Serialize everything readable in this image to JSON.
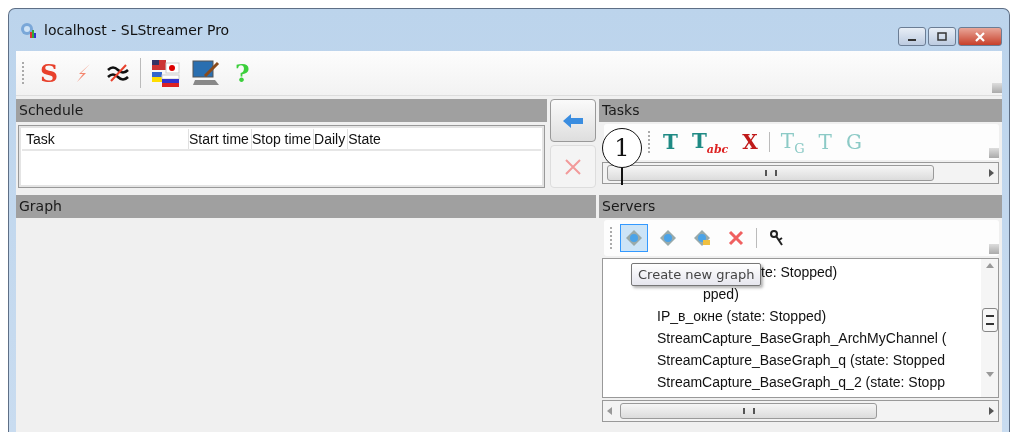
{
  "window": {
    "title": "localhost - SLStreamer Pro"
  },
  "toolbar": {
    "items": [
      {
        "kind": "glyph",
        "glyph": "S",
        "color": "#e8412c"
      },
      {
        "kind": "bolt"
      },
      {
        "kind": "waves"
      },
      {
        "kind": "sep"
      },
      {
        "kind": "flags"
      },
      {
        "kind": "monitor"
      },
      {
        "kind": "glyph",
        "glyph": "?",
        "color": "#3ccf3c"
      }
    ]
  },
  "schedule": {
    "title": "Schedule",
    "columns": [
      "Task",
      "Start time",
      "Stop time",
      "Daily",
      "State"
    ]
  },
  "side_buttons": [
    {
      "kind": "arrow",
      "disabled": false
    },
    {
      "kind": "delete",
      "disabled": true
    }
  ],
  "tasks": {
    "title": "Tasks",
    "tools": [
      {
        "kind": "plain",
        "glyph": "T",
        "disabled": false
      },
      {
        "kind": "abc",
        "glyph": "T",
        "sub": "abc",
        "disabled": false
      },
      {
        "kind": "cross",
        "glyph": "X",
        "disabled": false
      },
      {
        "kind": "sep"
      },
      {
        "kind": "sub",
        "glyph": "T",
        "sub": "G",
        "disabled": true
      },
      {
        "kind": "cross-sub",
        "glyph": "T",
        "disabled": true
      },
      {
        "kind": "tree",
        "glyph": "G",
        "disabled": true
      }
    ]
  },
  "graph": {
    "title": "Graph"
  },
  "servers": {
    "title": "Servers",
    "tools": [
      {
        "kind": "diamond",
        "selected": true
      },
      {
        "kind": "diamond",
        "selected": false
      },
      {
        "kind": "diamond-folder",
        "selected": false
      },
      {
        "kind": "delete",
        "selected": false
      },
      {
        "kind": "sep"
      },
      {
        "kind": "key",
        "selected": false
      }
    ],
    "items": [
      {
        "text": "te: Stopped)",
        "covered": true
      },
      {
        "text": "pped)",
        "covered": true
      },
      {
        "text": "IP_в_окне (state: Stopped)",
        "covered": false
      },
      {
        "text": "StreamCapture_BaseGraph_ArchMyChannel (",
        "covered": false
      },
      {
        "text": "StreamCapture_BaseGraph_q (state: Stopped",
        "covered": false
      },
      {
        "text": "StreamCapture_BaseGraph_q_2 (state: Stopp",
        "covered": false
      }
    ],
    "tooltip": "Create new graph"
  },
  "callout": "1"
}
